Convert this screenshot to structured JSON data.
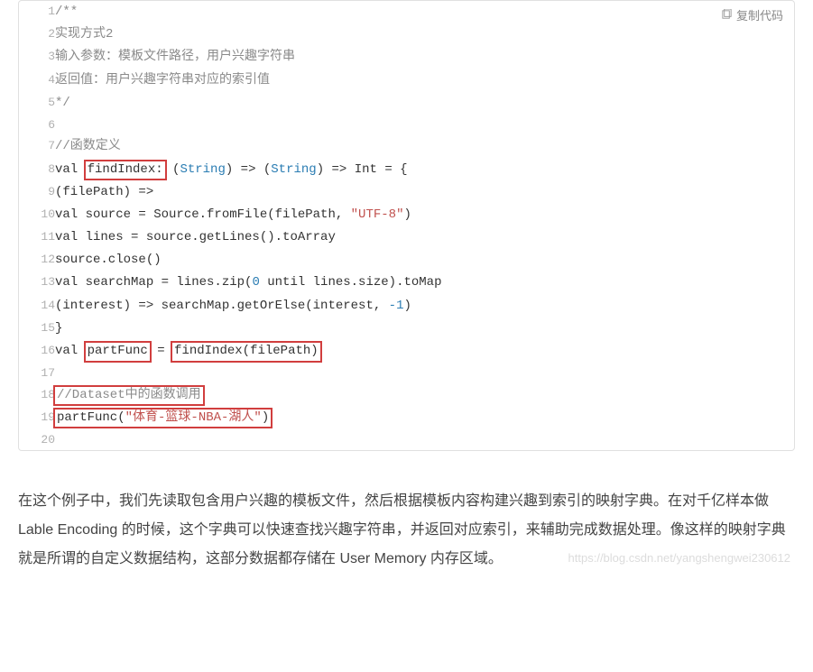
{
  "copy_label": "复制代码",
  "code": {
    "line1_a": "/**",
    "line2_a": "实现方式2",
    "line3_a": "输入参数：模板文件路径，用户兴趣字符串",
    "line4_a": "返回值：用户兴趣字符串对应的索引值",
    "line5_a": "*/",
    "line6_a": "",
    "line7_a": "//函数定义",
    "line8_a": "val ",
    "line8_hl": "findIndex:",
    "line8_b": " (",
    "line8_t1": "String",
    "line8_c": ") => (",
    "line8_t2": "String",
    "line8_d": ") => Int = {",
    "line9_a": "(filePath) =>",
    "line10_a": "val source = Source.fromFile(filePath, ",
    "line10_s": "\"UTF-8\"",
    "line10_b": ")",
    "line11_a": "val lines = source.getLines().toArray",
    "line12_a": "source.close()",
    "line13_a": "val searchMap = lines.zip(",
    "line13_n": "0",
    "line13_b": " until lines.size).toMap",
    "line14_a": "(interest) => searchMap.getOrElse(interest, ",
    "line14_n": "-1",
    "line14_b": ")",
    "line15_a": "}",
    "line16_a": "val ",
    "line16_hl1": "partFunc",
    "line16_b": " = ",
    "line16_hl2": "findIndex(filePath)",
    "line17_a": "",
    "line18_hl": "//Dataset中的函数调用",
    "line19_a": "partFunc(",
    "line19_s": "\"体育-篮球-NBA-湖人\"",
    "line19_b": ")",
    "line20_a": ""
  },
  "linenos": {
    "n1": "1",
    "n2": "2",
    "n3": "3",
    "n4": "4",
    "n5": "5",
    "n6": "6",
    "n7": "7",
    "n8": "8",
    "n9": "9",
    "n10": "10",
    "n11": "11",
    "n12": "12",
    "n13": "13",
    "n14": "14",
    "n15": "15",
    "n16": "16",
    "n17": "17",
    "n18": "18",
    "n19": "19",
    "n20": "20"
  },
  "paragraph": "在这个例子中，我们先读取包含用户兴趣的模板文件，然后根据模板内容构建兴趣到索引的映射字典。在对千亿样本做 Lable Encoding 的时候，这个字典可以快速查找兴趣字符串，并返回对应索引，来辅助完成数据处理。像这样的映射字典就是所谓的自定义数据结构，这部分数据都存储在 User Memory 内存区域。",
  "watermark": "https://blog.csdn.net/yangshengwei230612"
}
